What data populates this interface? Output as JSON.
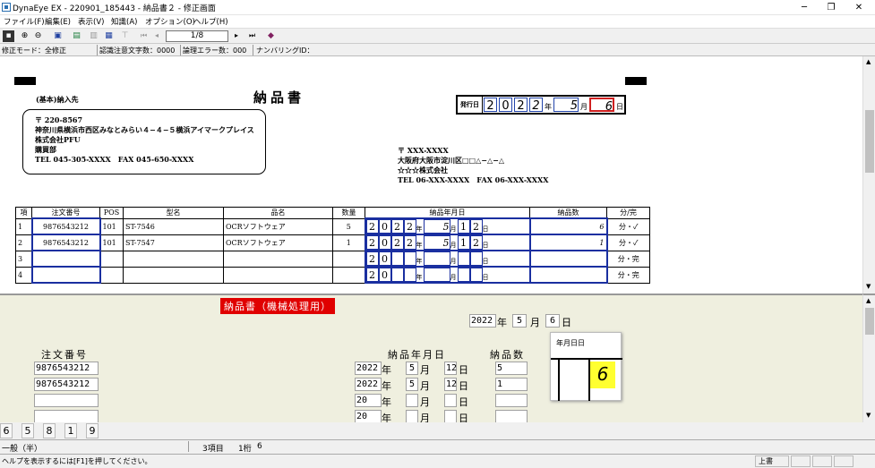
{
  "window": {
    "title": "DynaEye EX - 220901_185443 - 納品書２ - 修正画面",
    "minimize": "─",
    "restore": "❐",
    "close": "✕"
  },
  "menu": [
    "ファイル(F)",
    "編集(E)",
    "表示(V)",
    "知識(A)",
    "オプション(O)",
    "ヘルプ(H)"
  ],
  "toolbar": {
    "page": "1/8",
    "first": "⏮",
    "prev": "◂",
    "next": "▸",
    "last": "⏭"
  },
  "status": {
    "mode": "修正モード：全修正",
    "caution": "認識注意文字数：0000",
    "logic_err": "論理エラー数：000",
    "numbering": "ナンバリングID："
  },
  "doc": {
    "title": "納品書",
    "label_addressee": "(基本)納入先",
    "addr_lines": [
      "〒 220-8567",
      "神奈川県横浜市西区みなとみらい４−４−５横浜アイマークプレイス",
      "株式会社PFU",
      "購買部",
      "TEL 045-305-XXXX　FAX 045-650-XXXX"
    ],
    "issuer_lines": [
      "〒 XXX-XXXX",
      "大阪府大阪市淀川区□□△−△−△",
      "☆☆☆株式会社",
      "TEL 06-XXX-XXXX　FAX 06-XXX-XXXX"
    ],
    "issue_label": "発行日",
    "issue_digits": [
      "2",
      "0",
      "2",
      "2"
    ],
    "issue_month": "5",
    "issue_day": "6",
    "unit_year": "年",
    "unit_month": "月",
    "unit_day": "日",
    "headers": [
      "項",
      "注文番号",
      "POS",
      "型名",
      "品名",
      "数量",
      "納品年月日",
      "納品数",
      "分/完"
    ],
    "rows": [
      {
        "no": "1",
        "order": "9876543212",
        "pos": "101",
        "model": "ST-7546",
        "name": "OCRソフトウェア",
        "qty": "5",
        "y": [
          "2",
          "0",
          "2",
          "2"
        ],
        "m": "5",
        "d1": "1",
        "d2": "2",
        "count": "6",
        "mark": "分・✓"
      },
      {
        "no": "2",
        "order": "9876543212",
        "pos": "101",
        "model": "ST-7547",
        "name": "OCRソフトウェア",
        "qty": "1",
        "y": [
          "2",
          "0",
          "2",
          "2"
        ],
        "m": "5",
        "d1": "1",
        "d2": "2",
        "count": "1",
        "mark": "分・✓"
      },
      {
        "no": "3",
        "order": "",
        "pos": "",
        "model": "",
        "name": "",
        "qty": "",
        "y": [
          "2",
          "0",
          "",
          ""
        ],
        "m": "",
        "d1": "",
        "d2": "",
        "count": "",
        "mark": "分・完"
      },
      {
        "no": "4",
        "order": "",
        "pos": "",
        "model": "",
        "name": "",
        "qty": "",
        "y": [
          "2",
          "0",
          "",
          ""
        ],
        "m": "",
        "d1": "",
        "d2": "",
        "count": "",
        "mark": "分・完"
      }
    ]
  },
  "form": {
    "header": "納品書（機械処理用）",
    "issue_year": "2022",
    "issue_month": "5",
    "issue_day": "6",
    "unit_year": "年",
    "unit_month": "月",
    "unit_day": "日",
    "col_order": "注文番号",
    "col_date": "納品年月日",
    "col_count": "納品数",
    "orders": [
      "9876543212",
      "9876543212",
      "",
      ""
    ],
    "dates": [
      {
        "y": "2022",
        "m": "5",
        "d": "12"
      },
      {
        "y": "2022",
        "m": "5",
        "d": "12"
      },
      {
        "y": "20",
        "m": "",
        "d": ""
      },
      {
        "y": "20",
        "m": "",
        "d": ""
      }
    ],
    "counts": [
      "5",
      "1",
      "",
      ""
    ],
    "popup_title": "年月日日",
    "popup_char": "6"
  },
  "digits": [
    "6",
    "5",
    "8",
    "1",
    "9"
  ],
  "footer": {
    "charset": "一般（半）",
    "item": "3項目",
    "digit": "1桁",
    "value": "6",
    "help": "ヘルプを表示するには[F1]を押してください。",
    "mode": "上書"
  }
}
